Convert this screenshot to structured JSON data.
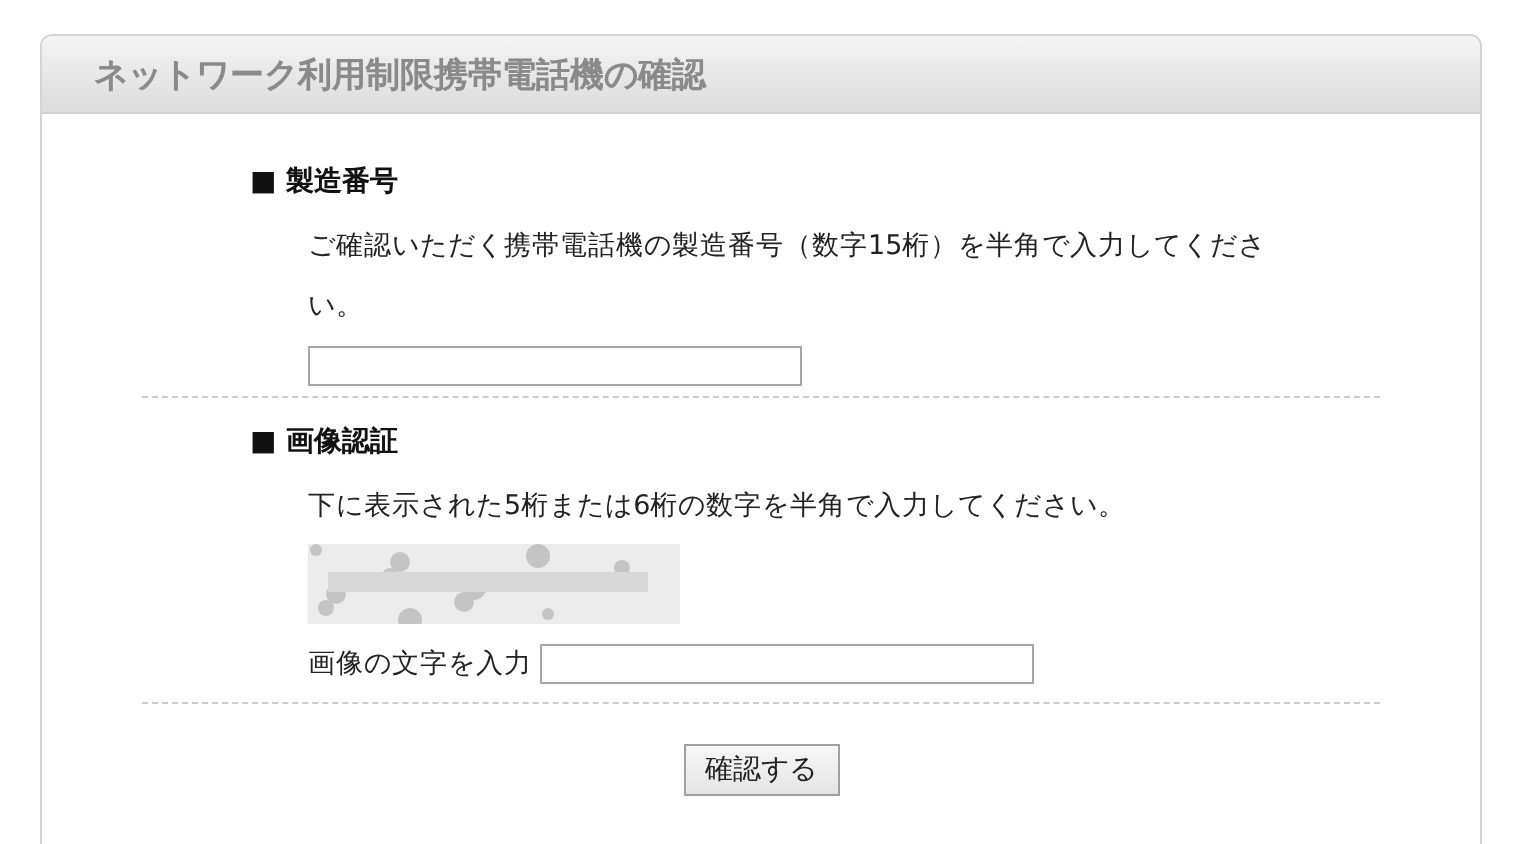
{
  "panel": {
    "title": "ネットワーク利用制限携帯電話機の確認"
  },
  "sections": [
    {
      "kind": "serial",
      "heading": "■ 製造番号",
      "instruction": "ご確認いただく携帯電話機の製造番号（数字15桁）を半角で入力してください。"
    },
    {
      "kind": "captcha",
      "heading": "■ 画像認証",
      "instruction": "下に表示された5桁または6桁の数字を半角で入力してください。",
      "field_label": "画像の文字を入力"
    }
  ],
  "submit_button": "確認する"
}
